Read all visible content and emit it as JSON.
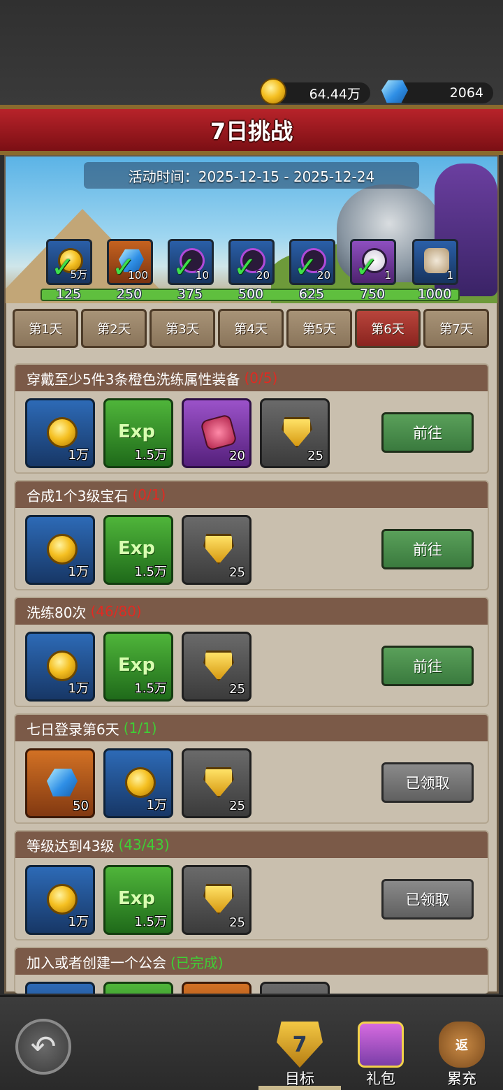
{
  "currency": {
    "gold": "64.44万",
    "gems": "2064"
  },
  "title": "7日挑战",
  "activity_time": "活动时间：2025-12-15 - 2025-12-24",
  "milestones": [
    {
      "qty": "5万",
      "label": "125"
    },
    {
      "qty": "100",
      "label": "250"
    },
    {
      "qty": "10",
      "label": "375"
    },
    {
      "qty": "20",
      "label": "500"
    },
    {
      "qty": "20",
      "label": "625"
    },
    {
      "qty": "1",
      "label": "750"
    },
    {
      "qty": "1",
      "label": "1000"
    }
  ],
  "tabs": [
    "第1天",
    "第2天",
    "第3天",
    "第4天",
    "第5天",
    "第6天",
    "第7天"
  ],
  "active_tab": "第6天",
  "tasks": [
    {
      "title": "穿戴至少5件3条橙色洗练属性装备",
      "progress": "(0/5)",
      "button": "前往",
      "rewards": [
        {
          "icon": "coin-icon",
          "qty": "1万"
        },
        {
          "icon": "exp-icon",
          "label": "Exp",
          "qty": "1.5万"
        },
        {
          "icon": "rune-icon",
          "qty": "20"
        },
        {
          "icon": "shield-icon",
          "qty": "25"
        }
      ]
    },
    {
      "title": "合成1个3级宝石",
      "progress": "(0/1)",
      "button": "前往",
      "rewards": [
        {
          "icon": "coin-icon",
          "qty": "1万"
        },
        {
          "icon": "exp-icon",
          "label": "Exp",
          "qty": "1.5万"
        },
        {
          "icon": "shield-icon",
          "qty": "25"
        }
      ]
    },
    {
      "title": "洗练80次",
      "progress": "(46/80)",
      "button": "前往",
      "rewards": [
        {
          "icon": "coin-icon",
          "qty": "1万"
        },
        {
          "icon": "exp-icon",
          "label": "Exp",
          "qty": "1.5万"
        },
        {
          "icon": "shield-icon",
          "qty": "25"
        }
      ]
    },
    {
      "title": "七日登录第6天",
      "progress": "(1/1)",
      "button": "已领取",
      "rewards": [
        {
          "icon": "gem-icon",
          "qty": "50"
        },
        {
          "icon": "coin-icon",
          "qty": "1万"
        },
        {
          "icon": "shield-icon",
          "qty": "25"
        }
      ]
    },
    {
      "title": "等级达到43级",
      "progress": "(43/43)",
      "button": "已领取",
      "rewards": [
        {
          "icon": "coin-icon",
          "qty": "1万"
        },
        {
          "icon": "exp-icon",
          "label": "Exp",
          "qty": "1.5万"
        },
        {
          "icon": "shield-icon",
          "qty": "25"
        }
      ]
    },
    {
      "title": "加入或者创建一个公会",
      "progress": "(已完成)"
    }
  ],
  "nav": {
    "goal": "目标",
    "goal_badge": "7",
    "gift": "礼包",
    "recharge": "累充",
    "recharge_badge": "返"
  },
  "colors": {
    "progress_incomplete": "#e02a22",
    "progress_complete": "#3fcf35",
    "go_button": "#4a8f4c",
    "claimed_button": "#757575",
    "active_tab": "#a5342d"
  }
}
